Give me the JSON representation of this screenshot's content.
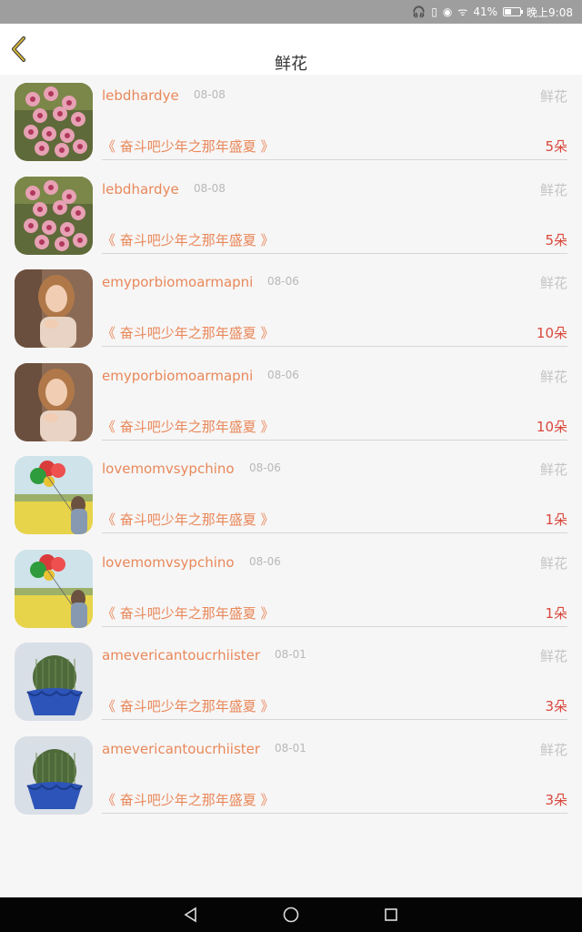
{
  "status": {
    "battery_pct": "41%",
    "time": "晚上9:08",
    "battery_level": 0.41
  },
  "header": {
    "title": "鲜花"
  },
  "items": [
    {
      "name": "lebdhardye",
      "date": "08-08",
      "category": "鲜花",
      "work": "《 奋斗吧少年之那年盛夏 》",
      "count": "5朵",
      "avatar": "flower"
    },
    {
      "name": "lebdhardye",
      "date": "08-08",
      "category": "鲜花",
      "work": "《 奋斗吧少年之那年盛夏 》",
      "count": "5朵",
      "avatar": "flower"
    },
    {
      "name": "emyporbiomoarmapni",
      "date": "08-06",
      "category": "鲜花",
      "work": "《 奋斗吧少年之那年盛夏 》",
      "count": "10朵",
      "avatar": "girl"
    },
    {
      "name": "emyporbiomoarmapni",
      "date": "08-06",
      "category": "鲜花",
      "work": "《 奋斗吧少年之那年盛夏 》",
      "count": "10朵",
      "avatar": "girl"
    },
    {
      "name": "lovemomvsypchino",
      "date": "08-06",
      "category": "鲜花",
      "work": "《 奋斗吧少年之那年盛夏 》",
      "count": "1朵",
      "avatar": "balloons"
    },
    {
      "name": "lovemomvsypchino",
      "date": "08-06",
      "category": "鲜花",
      "work": "《 奋斗吧少年之那年盛夏 》",
      "count": "1朵",
      "avatar": "balloons"
    },
    {
      "name": "amevericantoucrhiister",
      "date": "08-01",
      "category": "鲜花",
      "work": "《 奋斗吧少年之那年盛夏 》",
      "count": "3朵",
      "avatar": "cactus"
    },
    {
      "name": "amevericantoucrhiister",
      "date": "08-01",
      "category": "鲜花",
      "work": "《 奋斗吧少年之那年盛夏 》",
      "count": "3朵",
      "avatar": "cactus"
    }
  ],
  "colors": {
    "name": "#e8885a",
    "count": "#d8473c",
    "muted": "#c4c4c4",
    "back_arrow": "#c9a227"
  }
}
